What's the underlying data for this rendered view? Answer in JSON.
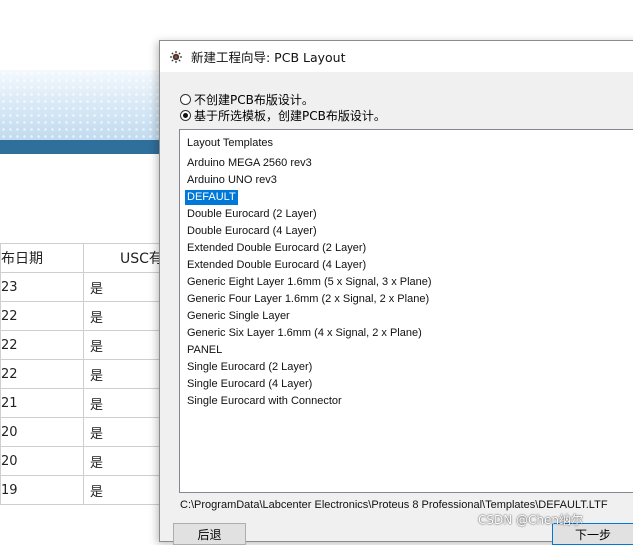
{
  "background_page": {
    "table": {
      "headers": [
        "布日期",
        "USC有"
      ],
      "rows": [
        [
          "23",
          "是"
        ],
        [
          "22",
          "是"
        ],
        [
          "22",
          "是"
        ],
        [
          "22",
          "是"
        ],
        [
          "21",
          "是"
        ],
        [
          "20",
          "是"
        ],
        [
          "20",
          "是"
        ],
        [
          "19",
          "是"
        ]
      ]
    }
  },
  "dialog": {
    "title": "新建工程向导: PCB Layout",
    "icon": "proteus-app-icon",
    "options": [
      {
        "label": "不创建PCB布版设计。",
        "checked": false
      },
      {
        "label": "基于所选模板，创建PCB布版设计。",
        "checked": true
      }
    ],
    "list_header": "Layout Templates",
    "templates": [
      "Arduino MEGA 2560 rev3",
      "Arduino UNO rev3",
      "DEFAULT",
      "Double Eurocard (2 Layer)",
      "Double Eurocard (4 Layer)",
      "Extended Double Eurocard (2 Layer)",
      "Extended Double Eurocard (4 Layer)",
      "Generic Eight Layer 1.6mm (5 x Signal, 3 x Plane)",
      "Generic Four Layer 1.6mm (2 x Signal, 2 x Plane)",
      "Generic Single Layer",
      "Generic Six Layer 1.6mm (4 x Signal, 2 x Plane)",
      "PANEL",
      "Single Eurocard (2 Layer)",
      "Single Eurocard (4 Layer)",
      "Single Eurocard with Connector"
    ],
    "selected_template": "DEFAULT",
    "template_path": "C:\\ProgramData\\Labcenter Electronics\\Proteus 8 Professional\\Templates\\DEFAULT.LTF",
    "buttons": {
      "back": "后退",
      "next": "下一步"
    }
  },
  "watermark": "CSDN @Chen纳尔",
  "colors": {
    "selection": "#0078d7",
    "banner_bar": "#2f6f9c"
  }
}
